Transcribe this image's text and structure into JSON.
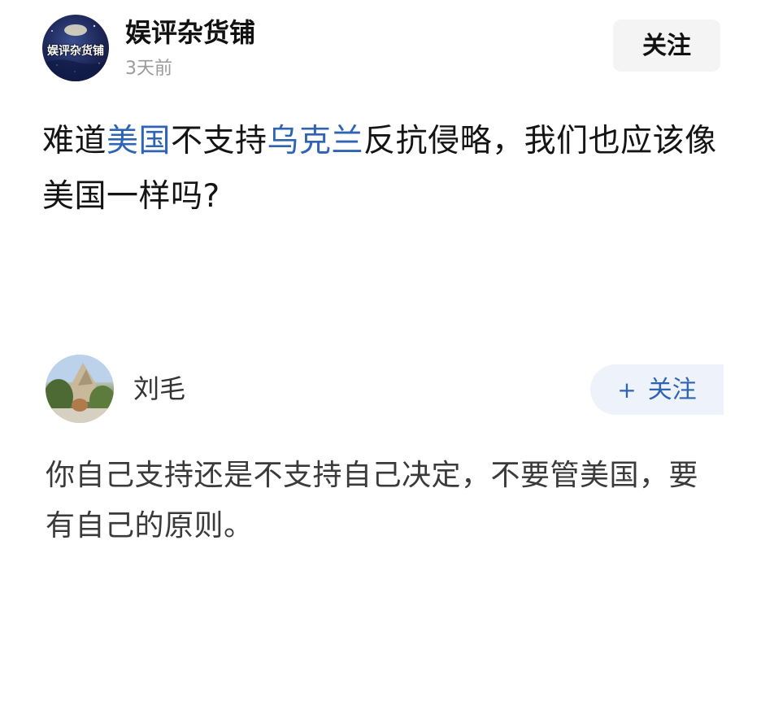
{
  "post": {
    "author": {
      "name": "娱评杂货铺",
      "avatar_text": "娱评杂货铺",
      "time": "3天前"
    },
    "follow_label": "关注",
    "content": {
      "seg1": "难道",
      "link1": "美国",
      "seg2": "不支持",
      "link2": "乌克兰",
      "seg3": "反抗侵略，我们也应该像美国一样吗?"
    }
  },
  "comment": {
    "author": "刘毛",
    "follow_plus": "+",
    "follow_label": "关注",
    "text": "你自己支持还是不支持自己决定，不要管美国，要有自己的原则。"
  },
  "colors": {
    "link": "#2f64b5",
    "follow_bg": "#f4f4f4",
    "comment_follow_bg": "#eef3fb"
  }
}
